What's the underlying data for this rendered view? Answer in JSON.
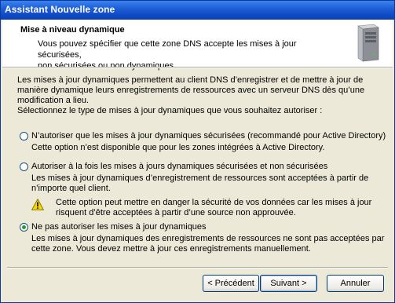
{
  "window": {
    "title": "Assistant Nouvelle zone"
  },
  "header": {
    "title": "Mise à niveau dynamique",
    "subtitle_line1": "Vous pouvez spécifier que cette zone DNS accepte les mises à jour sécurisées,",
    "subtitle_line2": "non sécurisées ou non dynamiques.",
    "icon": "server-icon"
  },
  "intro": {
    "line1": "Les mises à jour dynamiques permettent au client DNS d’enregistrer et de mettre à jour de",
    "line2": "manière dynamique leurs enregistrements de ressources avec un serveur DNS dès qu’une",
    "line3": "modification a lieu.",
    "line4": "Sélectionnez le type de mises à jour dynamiques que vous souhaitez autoriser :"
  },
  "options": [
    {
      "label": "N’autoriser que les mises à jour dynamiques sécurisées (recommandé pour Active Directory)",
      "desc1": "Cette option n’est disponible que pour les zones intégrées à Active Directory.",
      "selected": false
    },
    {
      "label": "Autoriser à la fois les mises à jours dynamiques sécurisées et non sécurisées",
      "desc1": "Les mises à jour dynamiques d’enregistrement de ressources sont acceptées à partir de",
      "desc2": "n’importe quel client.",
      "warning1": "Cette option peut mettre en danger la sécurité de vos données car les mises à jour",
      "warning2": "risquent d’être acceptées à partir d’une source non approuvée.",
      "selected": false
    },
    {
      "label": "Ne pas autoriser les mises à jour dynamiques",
      "desc1": "Les mises à jour dynamiques des enregistrements de ressources ne sont pas acceptées par",
      "desc2": "cette zone. Vous devez mettre à jour ces enregistrements manuellement.",
      "selected": true
    }
  ],
  "buttons": {
    "back": "< Précédent",
    "next": "Suivant >",
    "cancel": "Annuler"
  },
  "colors": {
    "titlebar": "#0d48c4",
    "radio_selected": "#21a121",
    "warning": "#f5d800"
  }
}
